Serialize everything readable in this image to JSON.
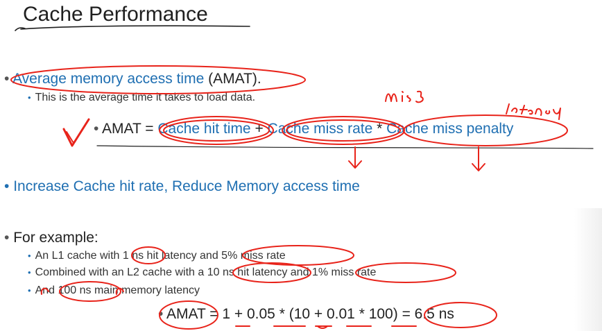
{
  "slide": {
    "title": "Cache Performance",
    "bullet_char": "•",
    "amat_def": {
      "highlight": "Average memory access time",
      "rest": " (AMAT)."
    },
    "amat_sub": "This is the average time it takes to load data.",
    "formula": {
      "prefix": "AMAT = ",
      "term1": "Cache hit time",
      "op1": " + ",
      "term2": "Cache miss rate",
      "op2": " * ",
      "term3": "Cache miss penalty"
    },
    "increase_line": "Increase Cache hit rate, Reduce Memory access time",
    "example_heading": "For example:",
    "example_items": [
      "An L1 cache with 1 ns hit latency and 5% miss rate",
      "Combined with an L2 cache with a 10 ns hit latency and 1% miss rate",
      "And 100 ns main memory latency"
    ],
    "example_formula": "AMAT = 1 + 0.05 * (10 + 0.01 * 100) = 6.5 ns"
  },
  "annotations": {
    "handwritten_miss": "miss",
    "handwritten_latency": "latency",
    "ink_color": "#e8231a"
  },
  "colors": {
    "accent_blue": "#1f6fb2",
    "text_dark": "#222222"
  }
}
